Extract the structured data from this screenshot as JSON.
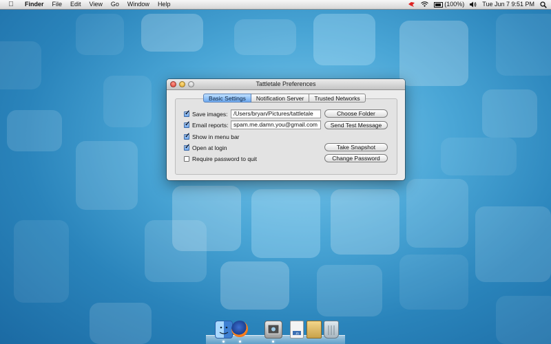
{
  "menubar": {
    "apple_icon": "apple-icon",
    "app_name": "Finder",
    "items": [
      "File",
      "Edit",
      "View",
      "Go",
      "Window",
      "Help"
    ],
    "status": {
      "battery": "(100%)",
      "datetime": "Tue Jun 7  9:51 PM"
    }
  },
  "window": {
    "title": "Tattletale Preferences",
    "tabs": [
      {
        "label": "Basic Settings",
        "active": true
      },
      {
        "label": "Notification Server",
        "active": false
      },
      {
        "label": "Trusted Networks",
        "active": false
      }
    ],
    "settings": {
      "save_images": {
        "label": "Save images:",
        "checked": true,
        "value": "/Users/bryan/Pictures/tattletale"
      },
      "email_reports": {
        "label": "Email reports:",
        "checked": true,
        "value": "spam.me.damn.you@gmail.com"
      },
      "show_menu_bar": {
        "label": "Show in menu bar",
        "checked": true
      },
      "open_at_login": {
        "label": "Open at login",
        "checked": true
      },
      "require_password": {
        "label": "Require password to quit",
        "checked": false
      }
    },
    "buttons": {
      "choose_folder": "Choose Folder",
      "send_test": "Send Test Message",
      "take_snapshot": "Take Snapshot",
      "change_password": "Change Password"
    }
  },
  "dock": {
    "items": [
      "finder-icon",
      "firefox-icon",
      "preview-icon",
      "document-icon",
      "notes-icon",
      "trash-icon"
    ]
  },
  "colors": {
    "tab_active": "#6eaaf0",
    "checkbox_checked": "#6ba4ea"
  }
}
